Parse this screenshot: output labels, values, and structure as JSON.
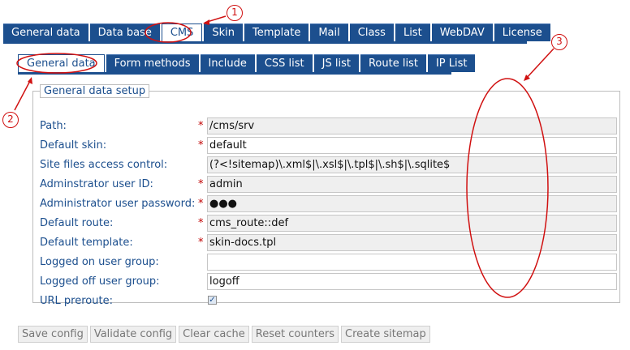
{
  "main_tabs": [
    "General data",
    "Data base",
    "CMS",
    "Skin",
    "Template",
    "Mail",
    "Class",
    "List",
    "WebDAV",
    "License"
  ],
  "sub_tabs": [
    "General data",
    "Form methods",
    "Include",
    "CSS list",
    "JS list",
    "Route list",
    "IP List"
  ],
  "panel": {
    "legend": "General data setup",
    "fields": [
      {
        "label": "Path:",
        "required": true,
        "value": "/cms/srv",
        "readonly": true
      },
      {
        "label": "Default skin:",
        "required": true,
        "value": "default",
        "readonly": false
      },
      {
        "label": "Site files access control:",
        "required": false,
        "value": "(?<!sitemap)\\.xml$|\\.xsl$|\\.tpl$|\\.sh$|\\.sqlite$",
        "readonly": true
      },
      {
        "label": "Adminstrator user ID:",
        "required": true,
        "value": "admin",
        "readonly": true
      },
      {
        "label": "Administrator user password:",
        "required": true,
        "value": "●●●",
        "readonly": true
      },
      {
        "label": "Default route:",
        "required": true,
        "value": "cms_route::def",
        "readonly": true
      },
      {
        "label": "Default template:",
        "required": true,
        "value": "skin-docs.tpl",
        "readonly": true
      },
      {
        "label": "Logged on user group:",
        "required": false,
        "value": "",
        "readonly": false
      },
      {
        "label": "Logged off user group:",
        "required": false,
        "value": "logoff",
        "readonly": false
      }
    ],
    "checkbox": {
      "label": "URL preroute:",
      "checked": true,
      "mark": "✓"
    },
    "required_mark": "*"
  },
  "buttons": [
    "Save config",
    "Validate config",
    "Clear cache",
    "Reset counters",
    "Create sitemap"
  ],
  "annotations": [
    "1",
    "2",
    "3"
  ],
  "colors": {
    "tab_bg": "#1c4f8e",
    "annotation": "#d01010",
    "required": "#c00000"
  }
}
